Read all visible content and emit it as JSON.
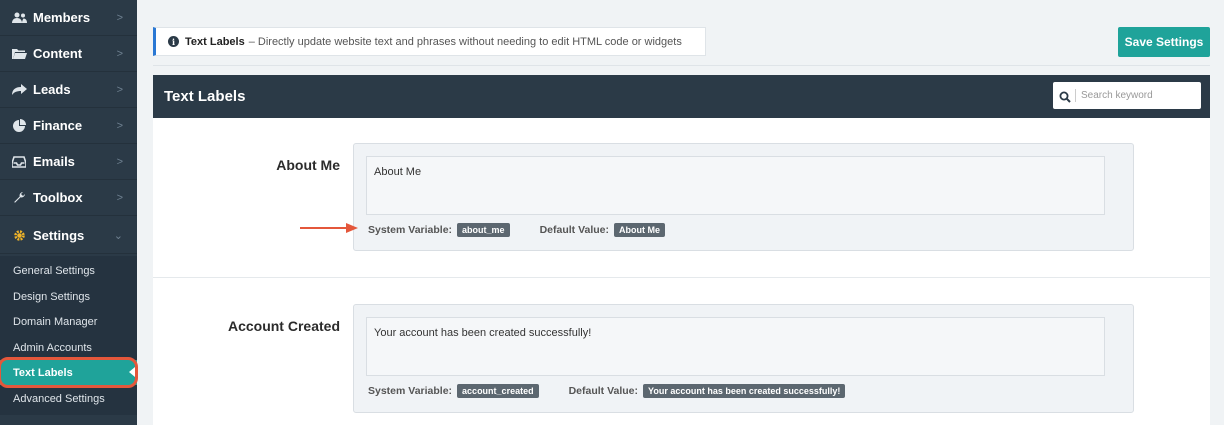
{
  "sidebar": {
    "items": [
      {
        "label": "Members",
        "icon": "users-icon"
      },
      {
        "label": "Content",
        "icon": "folder-icon"
      },
      {
        "label": "Leads",
        "icon": "share-icon"
      },
      {
        "label": "Finance",
        "icon": "pie-chart-icon"
      },
      {
        "label": "Emails",
        "icon": "inbox-icon"
      },
      {
        "label": "Toolbox",
        "icon": "wrench-icon"
      },
      {
        "label": "Settings",
        "icon": "gear-icon"
      }
    ],
    "sub_items": [
      {
        "label": "General Settings"
      },
      {
        "label": "Design Settings"
      },
      {
        "label": "Domain Manager"
      },
      {
        "label": "Admin Accounts"
      },
      {
        "label": "Text Labels",
        "active": true
      },
      {
        "label": "Advanced Settings"
      }
    ]
  },
  "notice": {
    "title": "Text Labels",
    "text": "– Directly update website text and phrases without needing to edit HTML code or widgets"
  },
  "save_button": "Save Settings",
  "panel": {
    "title": "Text Labels",
    "search_placeholder": "Search keyword"
  },
  "labels": [
    {
      "name": "About Me",
      "value": "About Me",
      "system_variable_label": "System Variable:",
      "system_variable": "about_me",
      "default_value_label": "Default Value:",
      "default_value": "About Me"
    },
    {
      "name": "Account Created",
      "value": "Your account has been created successfully!",
      "system_variable_label": "System Variable:",
      "system_variable": "account_created",
      "default_value_label": "Default Value:",
      "default_value": "Your account has been created successfully!"
    }
  ],
  "colors": {
    "sidebar_bg": "#2b3a47",
    "accent": "#1fa39a",
    "annotation": "#e4573b",
    "info_border": "#2a78d4"
  }
}
